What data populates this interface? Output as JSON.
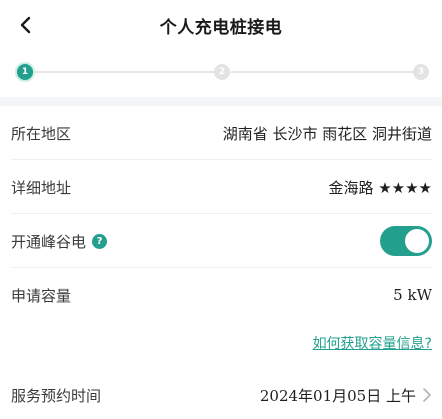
{
  "header": {
    "title": "个人充电桩接电"
  },
  "stepper": {
    "steps": [
      {
        "number": "1",
        "state": "active"
      },
      {
        "number": "2",
        "state": "todo"
      },
      {
        "number": "3",
        "state": "todo"
      }
    ]
  },
  "form": {
    "region": {
      "label": "所在地区",
      "value": "湖南省 长沙市 雨花区 洞井街道"
    },
    "address": {
      "label": "详细地址",
      "value": "金海路 ★★★★"
    },
    "peak_valley": {
      "label": "开通峰谷电",
      "help_glyph": "?",
      "enabled": true
    },
    "capacity": {
      "label": "申请容量",
      "value": "5 kW"
    },
    "capacity_link": "如何获取容量信息?",
    "appointment": {
      "label": "服务预约时间",
      "value": "2024年01月05日 上午"
    }
  },
  "colors": {
    "accent": "#23a08d",
    "divider": "#efefef",
    "band": "#f4f5f7"
  },
  "icons": {
    "back": "back-arrow-icon",
    "help": "help-icon",
    "chevron": "chevron-right-icon"
  }
}
